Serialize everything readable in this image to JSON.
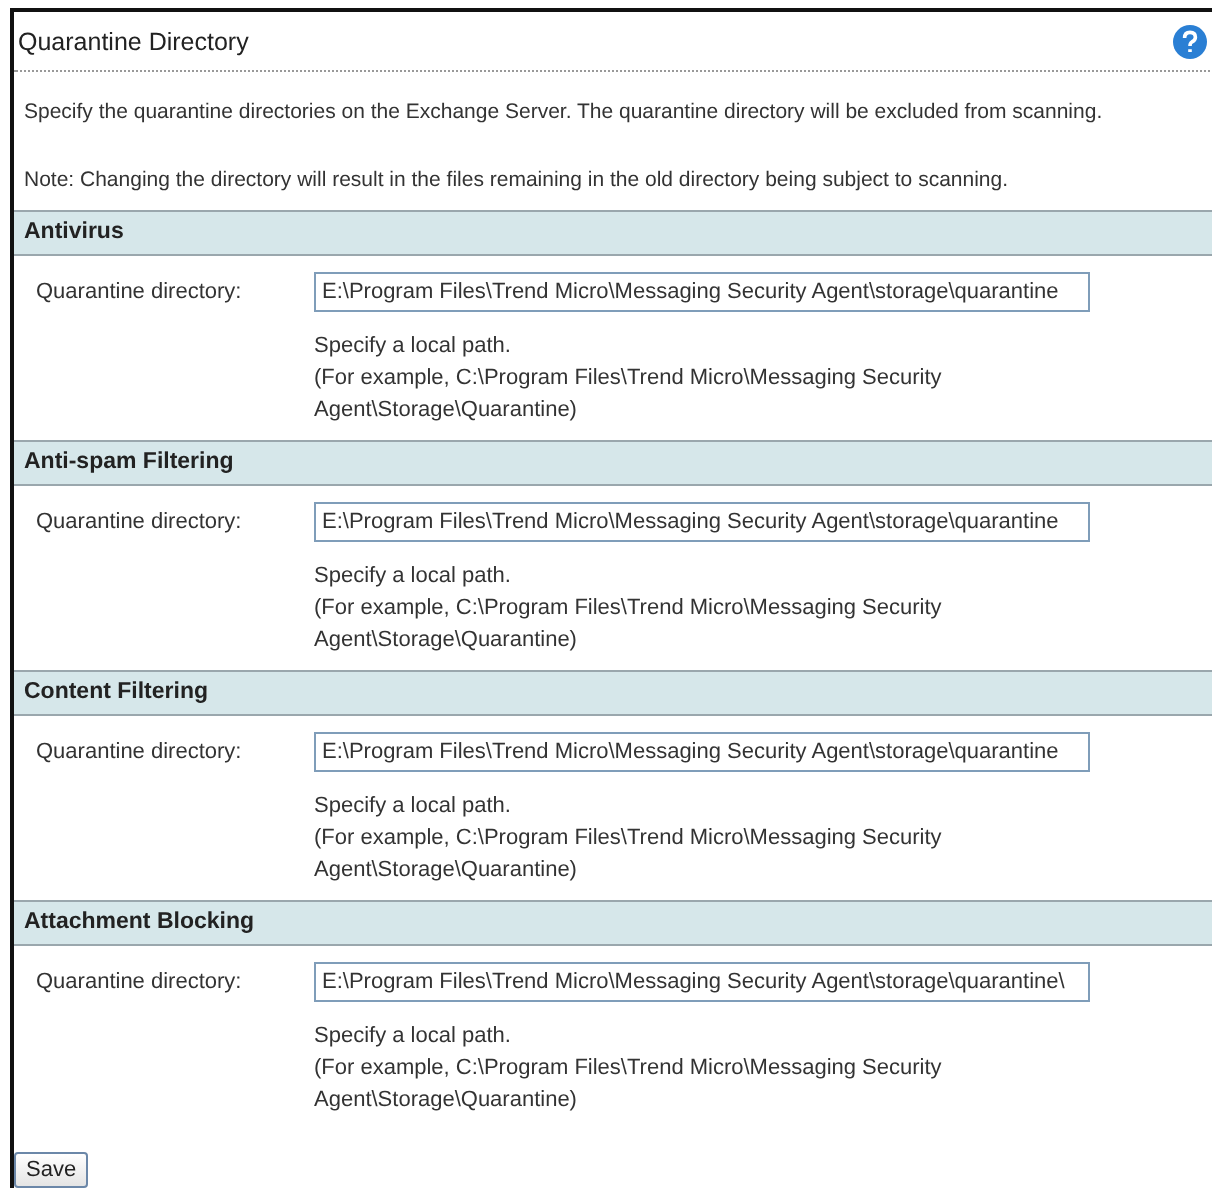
{
  "panel": {
    "title": "Quarantine Directory"
  },
  "intro": [
    "Specify the quarantine directories on the Exchange Server. The quarantine directory will be excluded from scanning.",
    "Note: Changing the directory will result in the files remaining in the old directory being subject to scanning."
  ],
  "sections": [
    {
      "title": "Antivirus",
      "label": "Quarantine directory:",
      "value": "E:\\Program Files\\Trend Micro\\Messaging Security Agent\\storage\\quarantine",
      "hint": [
        "Specify a local path.",
        "(For example, C:\\Program Files\\Trend Micro\\Messaging Security",
        "Agent\\Storage\\Quarantine)"
      ]
    },
    {
      "title": "Anti-spam Filtering",
      "label": "Quarantine directory:",
      "value": "E:\\Program Files\\Trend Micro\\Messaging Security Agent\\storage\\quarantine",
      "hint": [
        "Specify a local path.",
        "(For example, C:\\Program Files\\Trend Micro\\Messaging Security",
        "Agent\\Storage\\Quarantine)"
      ]
    },
    {
      "title": "Content Filtering",
      "label": "Quarantine directory:",
      "value": "E:\\Program Files\\Trend Micro\\Messaging Security Agent\\storage\\quarantine",
      "hint": [
        "Specify a local path.",
        "(For example, C:\\Program Files\\Trend Micro\\Messaging Security",
        "Agent\\Storage\\Quarantine)"
      ]
    },
    {
      "title": "Attachment Blocking",
      "label": "Quarantine directory:",
      "value": "E:\\Program Files\\Trend Micro\\Messaging Security Agent\\storage\\quarantine\\",
      "hint": [
        "Specify a local path.",
        "(For example, C:\\Program Files\\Trend Micro\\Messaging Security",
        "Agent\\Storage\\Quarantine)"
      ]
    }
  ],
  "buttons": [
    "Save"
  ]
}
